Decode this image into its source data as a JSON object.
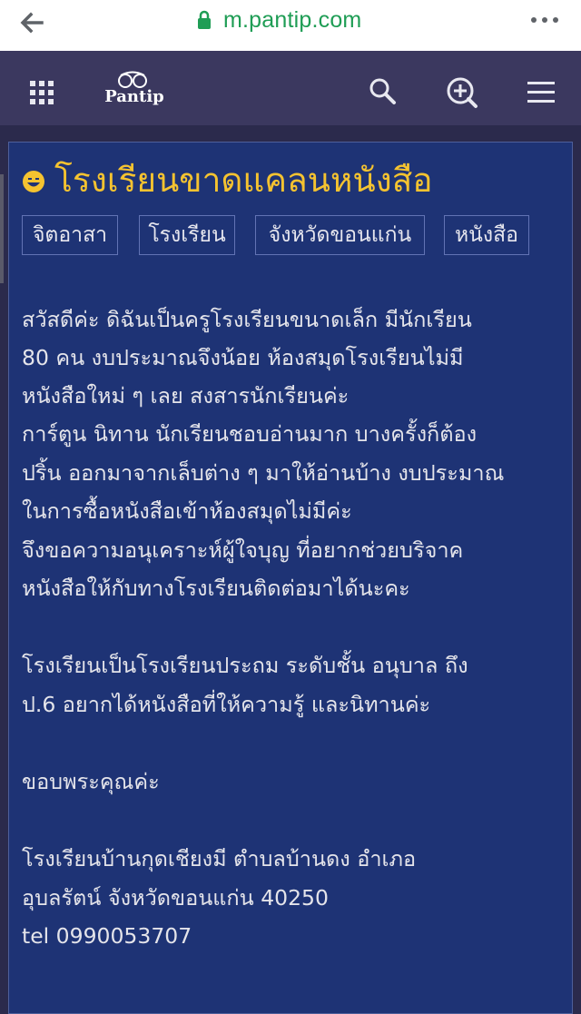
{
  "browser": {
    "url": "m.pantip.com"
  },
  "navbar": {
    "logo_text": "Pantip"
  },
  "topic": {
    "title": "โรงเรียนขาดแคลนหนังสือ",
    "tags": [
      "จิตอาสา",
      "โรงเรียน",
      "จังหวัดขอนแก่น",
      "หนังสือ"
    ],
    "body_lines": [
      "สวัสดีค่ะ  ดิฉันเป็นครูโรงเรียนขนาดเล็ก  มีนักเรียน",
      "80 คน  งบประมาณจึงน้อย ห้องสมุดโรงเรียนไม่มี",
      "หนังสือใหม่ ๆ เลย  สงสารนักเรียนค่ะ",
      "การ์ตูน  นิทาน  นักเรียนชอบอ่านมาก  บางครั้งก็ต้อง",
      "ปริ้น ออกมาจากเล็บต่าง ๆ มาให้อ่านบ้าง  งบประมาณ",
      "ในการซื้อหนังสือเข้าห้องสมุดไม่มีค่ะ",
      "จึงขอความอนุเคราะห์ผู้ใจบุญ ที่อยากช่วยบริจาค",
      "หนังสือให้กับทางโรงเรียนติดต่อมาได้นะคะ",
      "โรงเรียนเป็นโรงเรียนประถม  ระดับชั้น อนุบาล ถึง",
      "ป.6   อยากได้หนังสือที่ให้ความรู้ และนิทานค่ะ",
      "ขอบพระคุณค่ะ",
      "โรงเรียนบ้านกุดเชียงมี    ตำบลบ้านดง  อำเภอ",
      "อุบลรัตน์  จังหวัดขอนแก่น  40250",
      "tel  0990053707"
    ]
  },
  "colors": {
    "navbar": "#3b385f",
    "panel": "#1e3375",
    "title": "#f5c330",
    "url": "#1f9d55"
  }
}
